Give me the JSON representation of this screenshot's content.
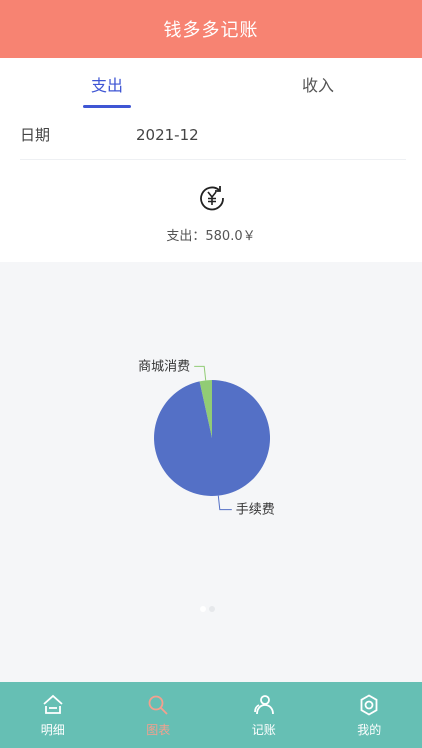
{
  "header": {
    "title": "钱多多记账"
  },
  "tabs": [
    {
      "label": "支出",
      "active": true
    },
    {
      "label": "收入",
      "active": false
    }
  ],
  "date": {
    "label": "日期",
    "value": "2021-12"
  },
  "summary": {
    "icon": "yen-cycle-icon",
    "text": "支出：580.0￥"
  },
  "chart_data": {
    "type": "pie",
    "title": "",
    "categories": [
      "商城消费",
      "手续费"
    ],
    "values": [
      20,
      560
    ],
    "colors": [
      "#91cc75",
      "#5470c6"
    ],
    "legend": "none"
  },
  "pager": {
    "count": 2,
    "active": 0
  },
  "nav": {
    "items": [
      {
        "label": "明细",
        "icon": "home-icon",
        "active": false
      },
      {
        "label": "图表",
        "icon": "search-icon",
        "active": true
      },
      {
        "label": "记账",
        "icon": "people-icon",
        "active": false
      },
      {
        "label": "我的",
        "icon": "gear-icon",
        "active": false
      }
    ]
  },
  "colors": {
    "header_bg": "#f78372",
    "accent": "#3f56d4",
    "nav_bg": "#66bfb4",
    "nav_active": "#f4a08e"
  }
}
